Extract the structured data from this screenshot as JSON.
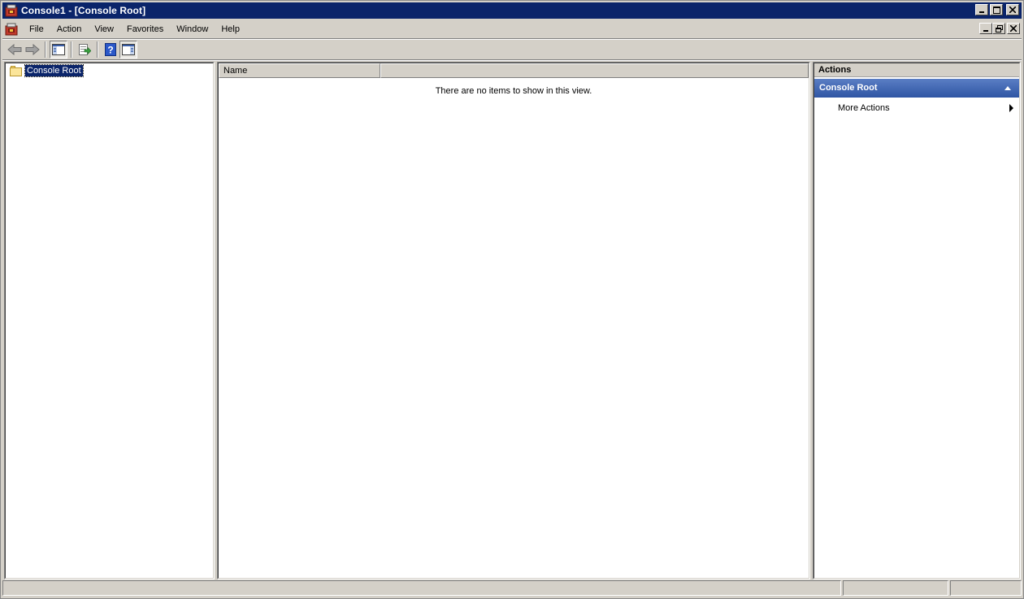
{
  "window": {
    "title": "Console1 - [Console Root]",
    "caption_buttons": [
      "minimize",
      "maximize",
      "close"
    ]
  },
  "menu": {
    "items": [
      "File",
      "Action",
      "View",
      "Favorites",
      "Window",
      "Help"
    ],
    "mdi_buttons": [
      "minimize",
      "restore",
      "close"
    ]
  },
  "toolbar": {
    "buttons": [
      "back-arrow-icon",
      "forward-arrow-icon",
      "show-hide-console-tree-icon",
      "export-list-icon",
      "help-icon",
      "show-hide-action-pane-icon"
    ]
  },
  "tree": {
    "root_label": "Console Root"
  },
  "list": {
    "columns": [
      "Name",
      ""
    ],
    "empty_message": "There are no items to show in this view."
  },
  "actions": {
    "header": "Actions",
    "section_title": "Console Root",
    "items": [
      "More Actions"
    ]
  },
  "colors": {
    "titlebar": "#0a246a",
    "section_header": "#3d63b0",
    "chrome": "#d4d0c8"
  }
}
